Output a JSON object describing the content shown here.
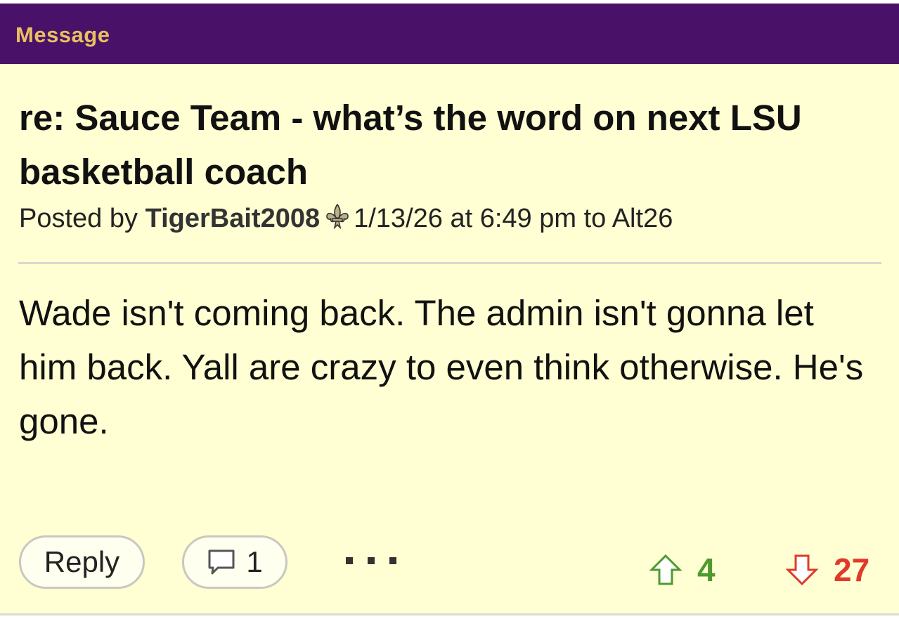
{
  "header": {
    "title": "Message"
  },
  "post": {
    "subject": "re: Sauce Team - what’s the word on next LSU basketball coach",
    "byline_prefix": "Posted by ",
    "author": "TigerBait2008",
    "byline_suffix": "1/13/26 at 6:49 pm to Alt26",
    "body": "Wade isn't coming back. The admin isn't gonna let him back. Yall are crazy to even think otherwise. He's gone."
  },
  "actions": {
    "reply_label": "Reply",
    "comment_count": "1",
    "upvotes": "4",
    "downvotes": "27"
  },
  "icons": {
    "fleur": "fleur-de-lis-icon",
    "comment": "speech-bubble-icon",
    "more": "ellipsis-icon",
    "upvote": "up-arrow-icon",
    "downvote": "down-arrow-icon"
  },
  "colors": {
    "header_bg": "#4a1169",
    "header_text": "#e8c060",
    "card_bg": "#ffffd3",
    "upvote": "#4f9a30",
    "downvote": "#e13a2a"
  }
}
